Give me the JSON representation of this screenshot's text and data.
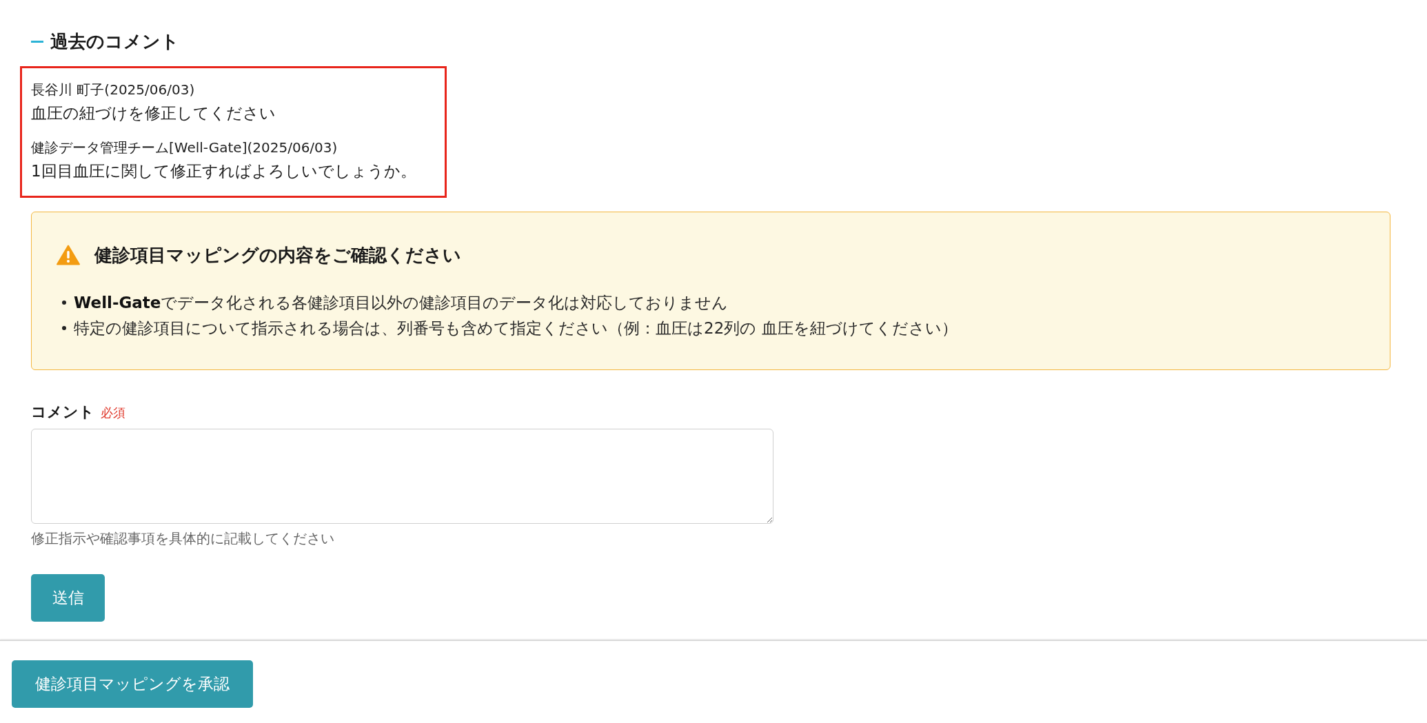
{
  "past_comments": {
    "title": "過去のコメント",
    "comments": [
      {
        "header": "長谷川 町子(2025/06/03)",
        "text": "血圧の紐づけを修正してください"
      },
      {
        "header": "健診データ管理チーム[Well-Gate](2025/06/03)",
        "text": "1回目血圧に関して修正すればよろしいでしょうか。"
      }
    ]
  },
  "notice": {
    "title": "健診項目マッピングの内容をご確認ください",
    "items": [
      "**Well-Gate**でデータ化される各健診項目以外の健診項目のデータ化は対応しておりません",
      "特定の健診項目について指示される場合は、列番号も含めて指定ください（例：血圧は22列の 血圧を紐づけてください）"
    ]
  },
  "comment_form": {
    "label": "コメント",
    "required_badge": "必須",
    "help": "修正指示や確認事項を具体的に記載してください",
    "submit": "送信"
  },
  "footer": {
    "approve_button": "健診項目マッピングを承認"
  }
}
